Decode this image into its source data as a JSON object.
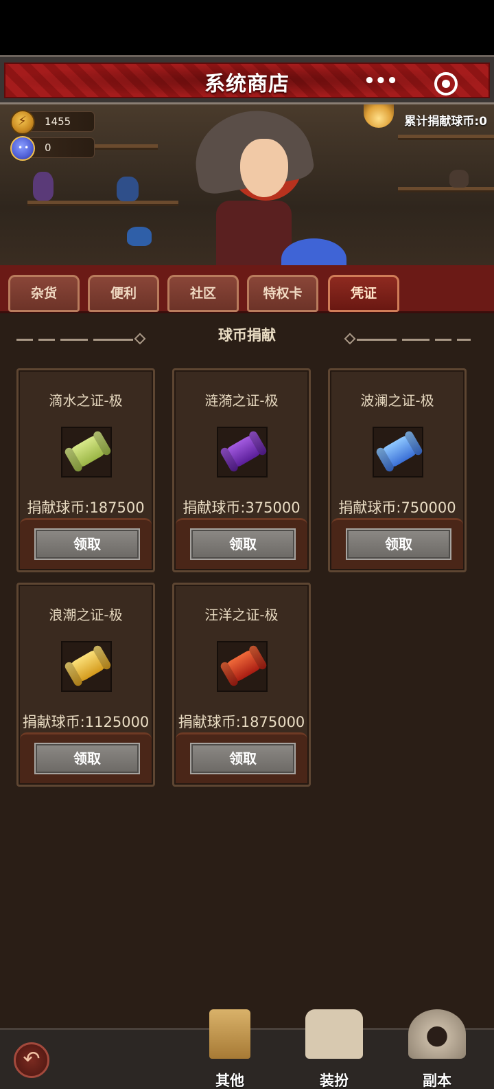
{
  "header": {
    "title": "系统商店",
    "more_label": "•••"
  },
  "currencies": [
    {
      "icon": "gold-coin-icon",
      "value": "1455"
    },
    {
      "icon": "blue-slime-icon",
      "value": "0"
    }
  ],
  "banner": {
    "donated_total": "累计捐献球币:0"
  },
  "tabs": [
    {
      "label": "杂货",
      "active": false
    },
    {
      "label": "便利",
      "active": false
    },
    {
      "label": "社区",
      "active": false
    },
    {
      "label": "特权卡",
      "active": false
    },
    {
      "label": "凭证",
      "active": true
    }
  ],
  "section": {
    "title": "球币捐献"
  },
  "cards": [
    {
      "name": "滴水之证-极",
      "cost": "捐献球币:187500",
      "button": "领取",
      "icon": "green-scroll-icon"
    },
    {
      "name": "涟漪之证-极",
      "cost": "捐献球币:375000",
      "button": "领取",
      "icon": "purple-scroll-icon"
    },
    {
      "name": "波澜之证-极",
      "cost": "捐献球币:750000",
      "button": "领取",
      "icon": "blue-scroll-icon"
    },
    {
      "name": "浪潮之证-极",
      "cost": "捐献球币:1125000",
      "button": "领取",
      "icon": "gold-scroll-icon"
    },
    {
      "name": "汪洋之证-极",
      "cost": "捐献球币:1875000",
      "button": "领取",
      "icon": "red-scroll-icon"
    }
  ],
  "bottom_nav": {
    "back_icon": "back-arrow-icon",
    "items": [
      {
        "label": "其他",
        "icon": "grocery-bag-icon"
      },
      {
        "label": "装扮",
        "icon": "shirt-icon"
      },
      {
        "label": "副本",
        "icon": "dungeon-skull-icon"
      }
    ]
  }
}
